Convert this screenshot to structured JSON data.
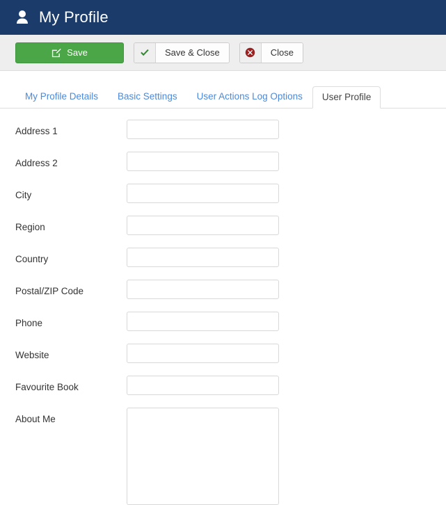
{
  "header": {
    "icon": "user-icon",
    "title": "My Profile",
    "bg_color": "#1b3c6b"
  },
  "toolbar": {
    "buttons": [
      {
        "label": "Save",
        "icon": "edit-square-icon",
        "style": "primary-green",
        "color": "#4aa646"
      },
      {
        "label": "Save & Close",
        "icon": "checkmark-icon",
        "style": "split-default",
        "color": "#4aa646"
      },
      {
        "label": "Close",
        "icon": "cancel-circle-icon",
        "style": "split-default",
        "color": "#a02020"
      }
    ]
  },
  "tabs": [
    {
      "label": "My Profile Details",
      "active": false
    },
    {
      "label": "Basic Settings",
      "active": false
    },
    {
      "label": "User Actions Log Options",
      "active": false
    },
    {
      "label": "User Profile",
      "active": true
    }
  ],
  "form": {
    "fields": [
      {
        "label": "Address 1",
        "value": "",
        "placeholder": "",
        "type": "text"
      },
      {
        "label": "Address 2",
        "value": "",
        "placeholder": "",
        "type": "text"
      },
      {
        "label": "City",
        "value": "",
        "placeholder": "",
        "type": "text"
      },
      {
        "label": "Region",
        "value": "",
        "placeholder": "",
        "type": "text"
      },
      {
        "label": "Country",
        "value": "",
        "placeholder": "",
        "type": "text"
      },
      {
        "label": "Postal/ZIP Code",
        "value": "",
        "placeholder": "",
        "type": "text"
      },
      {
        "label": "Phone",
        "value": "",
        "placeholder": "",
        "type": "text"
      },
      {
        "label": "Website",
        "value": "",
        "placeholder": "",
        "type": "text"
      },
      {
        "label": "Favourite Book",
        "value": "",
        "placeholder": "",
        "type": "text"
      },
      {
        "label": "About Me",
        "value": "",
        "placeholder": "",
        "type": "textarea"
      }
    ]
  }
}
